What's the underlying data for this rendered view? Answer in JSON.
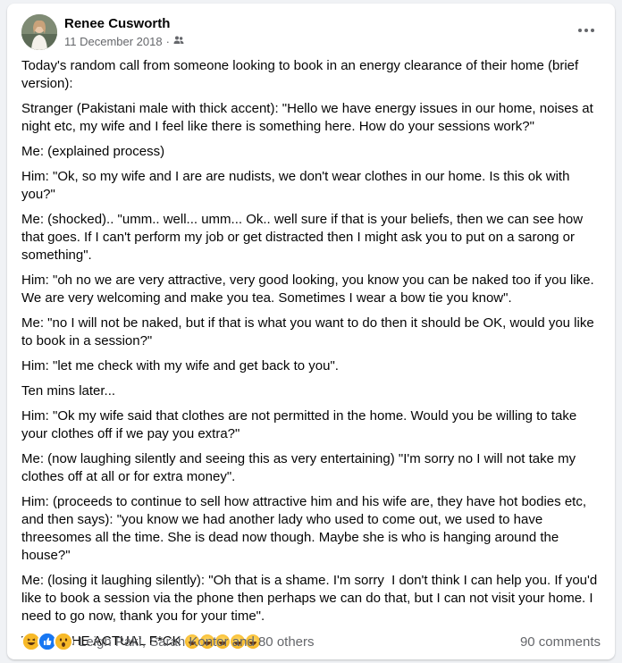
{
  "post": {
    "author": "Renee Cusworth",
    "date": "11 December 2018",
    "date_separator": "·",
    "audience_icon": "friends-icon",
    "paragraphs": [
      "Today's random call from someone looking to book in an energy clearance of their home (brief version):",
      "Stranger (Pakistani male with thick accent): \"Hello we have energy issues in our home, noises at night etc, my wife and I feel like there is something here. How do your sessions work?\"",
      "Me: (explained process)",
      "Him: \"Ok, so my wife and I are are nudists, we don't wear clothes in our home. Is this ok with you?\"",
      "Me: (shocked).. \"umm.. well... umm... Ok.. well sure if that is your beliefs, then we can see how that goes. If I can't perform my job or get distracted then I might ask you to put on a sarong or something\".",
      "Him: \"oh no we are very attractive, very good looking, you know you can be naked too if you like. We are very welcoming and make you tea. Sometimes I wear a bow tie you know\".",
      "Me: \"no I will not be naked, but if that is what you want to do then it should be OK, would you like to book in a session?\"",
      "Him: \"let me check with my wife and get back to you\".",
      "Ten mins later...",
      "Him: \"Ok my wife said that clothes are not permitted in the home. Would you be willing to take your clothes off if we pay you extra?\"",
      "Me: (now laughing silently and seeing this as very entertaining) \"I'm sorry no I will not take my clothes off at all or for extra money\".",
      "Him: (proceeds to continue to sell how attractive him and his wife are, they have hot bodies etc, and then says): \"you know we had another lady who used to come out, we used to have threesomes all the time. She is dead now though. Maybe she is who is hanging around the house?\"",
      "Me: (losing it laughing silently): \"Oh that is a shame. I'm sorry  I don't think I can help you. If you'd like to book a session via the phone then perhaps we can do that, but I can not visit your home. I need to go now, thank you for your time\"."
    ],
    "last_line": "WHAT THE ACTUAL F*CK",
    "last_line_emoji_count": 5,
    "last_line_emoji": "laughing-emoji"
  },
  "footer": {
    "reaction_icons": [
      "haha-icon",
      "like-icon",
      "wow-icon"
    ],
    "reactors": "Leigh Pakì, Sarah Kontor and 80 others",
    "comments": "90 comments"
  },
  "colors": {
    "background": "#f0f2f5",
    "card": "#ffffff",
    "text": "#050505",
    "secondary_text": "#65676b",
    "like_blue": "#1877f2",
    "reaction_yellow": "#f7b928"
  }
}
